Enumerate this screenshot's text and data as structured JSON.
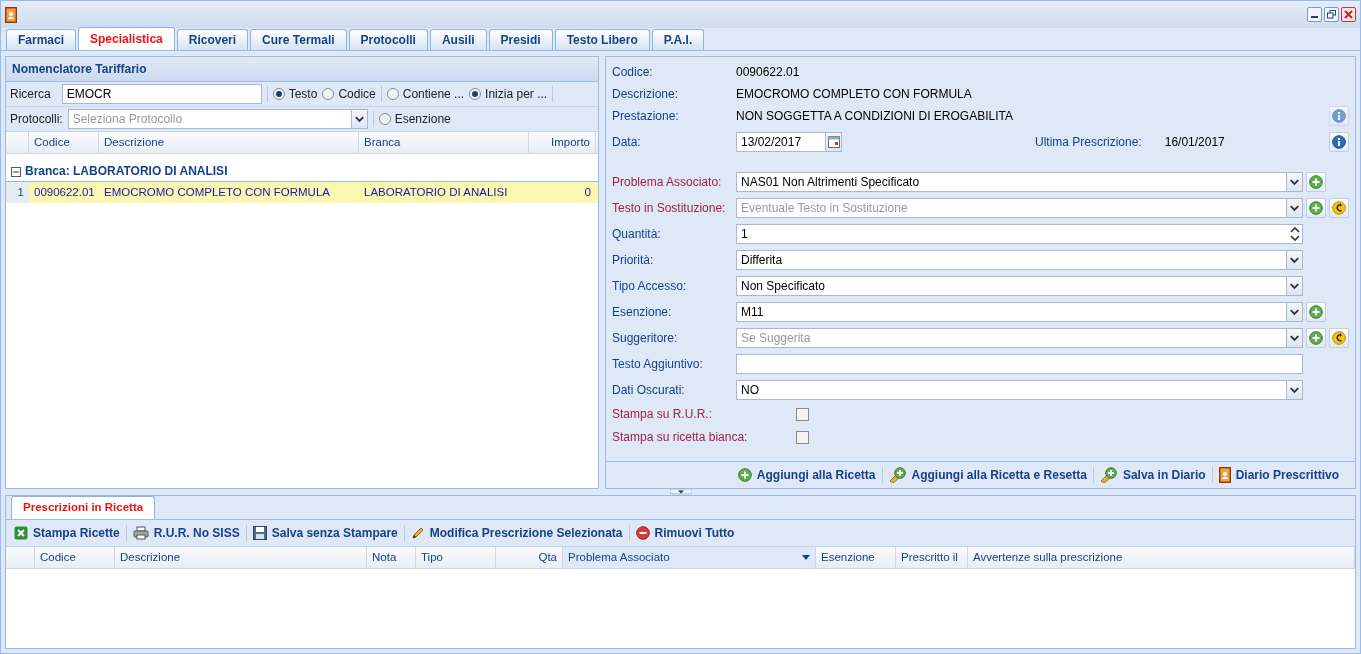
{
  "tabs": [
    {
      "label": "Farmaci",
      "selected": false
    },
    {
      "label": "Specialistica",
      "selected": true
    },
    {
      "label": "Ricoveri",
      "selected": false
    },
    {
      "label": "Cure Termali",
      "selected": false
    },
    {
      "label": "Protocolli",
      "selected": false
    },
    {
      "label": "Ausili",
      "selected": false
    },
    {
      "label": "Presidi",
      "selected": false
    },
    {
      "label": "Testo Libero",
      "selected": false
    },
    {
      "label": "P.A.I.",
      "selected": false
    }
  ],
  "nomenclatore": {
    "title": "Nomenclatore Tariffario",
    "search": {
      "label": "Ricerca",
      "value": "EMOCR"
    },
    "search_by": [
      {
        "label": "Testo",
        "selected": true
      },
      {
        "label": "Codice",
        "selected": false
      }
    ],
    "match": [
      {
        "label": "Contiene ...",
        "selected": false
      },
      {
        "label": "Inizia per ...",
        "selected": true
      }
    ],
    "protocolli": {
      "label": "Protocolli:",
      "placeholder": "Seleziona Protocollo"
    },
    "esenzione": {
      "label": "Esenzione",
      "selected": false
    },
    "columns": [
      "Codice",
      "Descrizione",
      "Branca",
      "Importo"
    ],
    "group": {
      "label": "Branca: LABORATORIO DI ANALISI",
      "expanded": true
    },
    "rows": [
      {
        "number": "1",
        "codice": "0090622.01",
        "descrizione": "EMOCROMO COMPLETO CON FORMULA",
        "branca": "LABORATORIO DI ANALISI",
        "importo": "0",
        "selected": true
      }
    ]
  },
  "detail": {
    "info": [
      {
        "label": "Codice:",
        "value": "0090622.01"
      },
      {
        "label": "Descrizione:",
        "value": "EMOCROMO COMPLETO CON FORMULA"
      },
      {
        "label": "Prestazione:",
        "value": "NON SOGGETTA A CONDIZIONI DI EROGABILITA",
        "info_button": {
          "disabled": true
        }
      }
    ],
    "data": {
      "label": "Data:",
      "value": "13/02/2017"
    },
    "ultima": {
      "label": "Ultima Prescrizione:",
      "value": "16/01/2017",
      "info_button": {
        "disabled": false
      }
    },
    "fields": [
      {
        "kind": "combo",
        "label": "Problema Associato:",
        "highlight": true,
        "value": "NAS01 Non Altrimenti Specificato",
        "add": true,
        "reset": false
      },
      {
        "kind": "combo",
        "label": "Testo in Sostituzione:",
        "highlight": true,
        "placeholder": "Eventuale Testo in Sostituzione",
        "add": true,
        "reset": true
      },
      {
        "kind": "spin",
        "label": "Quantità:",
        "highlight": false,
        "value": "1",
        "add": false,
        "reset": false
      },
      {
        "kind": "combo",
        "label": "Priorità:",
        "highlight": false,
        "value": "Differita",
        "add": false,
        "reset": false
      },
      {
        "kind": "combo",
        "label": "Tipo Accesso:",
        "highlight": false,
        "value": "Non Specificato",
        "add": false,
        "reset": false
      },
      {
        "kind": "combo",
        "label": "Esenzione:",
        "highlight": false,
        "value": "M11",
        "add": true,
        "reset": false
      },
      {
        "kind": "combo",
        "label": "Suggeritore:",
        "highlight": false,
        "placeholder": "Se Suggerita",
        "add": true,
        "reset": true
      },
      {
        "kind": "text",
        "label": "Testo Aggiuntivo:",
        "highlight": false,
        "add": false,
        "reset": false
      },
      {
        "kind": "combo",
        "label": "Dati Oscurati:",
        "highlight": false,
        "value": "NO",
        "add": false,
        "reset": false
      }
    ],
    "checkboxes": [
      {
        "label": "Stampa su R.U.R.:",
        "highlight": true,
        "checked": false
      },
      {
        "label": "Stampa su ricetta bianca:",
        "highlight": true,
        "checked": false
      }
    ],
    "actions": [
      {
        "kind": "add",
        "label": "Aggiungi alla Ricetta"
      },
      {
        "kind": "add_reset",
        "label": "Aggiungi alla Ricetta e Resetta"
      },
      {
        "kind": "save",
        "label": "Salva in Diario"
      },
      {
        "kind": "book",
        "label": "Diario Prescrittivo"
      }
    ]
  },
  "prescrizioni": {
    "tab": {
      "label": "Prescrizioni in Ricetta",
      "selected": true
    },
    "toolbar": [
      {
        "kind": "print",
        "label": "Stampa Ricette"
      },
      {
        "kind": "printer",
        "label": "R.U.R. No SISS"
      },
      {
        "kind": "floppy",
        "label": "Salva senza Stampare"
      },
      {
        "kind": "pencil",
        "label": "Modifica Prescrizione Selezionata"
      },
      {
        "kind": "remove",
        "label": "Rimuovi Tutto"
      }
    ],
    "columns": [
      {
        "label": "Codice",
        "sorted": false
      },
      {
        "label": "Descrizione",
        "sorted": false
      },
      {
        "label": "Nota",
        "sorted": false
      },
      {
        "label": "Tipo",
        "sorted": false
      },
      {
        "label": "Qta",
        "sorted": false
      },
      {
        "label": "Problema Associato",
        "sorted": true
      },
      {
        "label": "Esenzione",
        "sorted": false
      },
      {
        "label": "Prescritto il",
        "sorted": false
      },
      {
        "label": "Avvertenze sulla prescrizione",
        "sorted": false
      }
    ]
  }
}
